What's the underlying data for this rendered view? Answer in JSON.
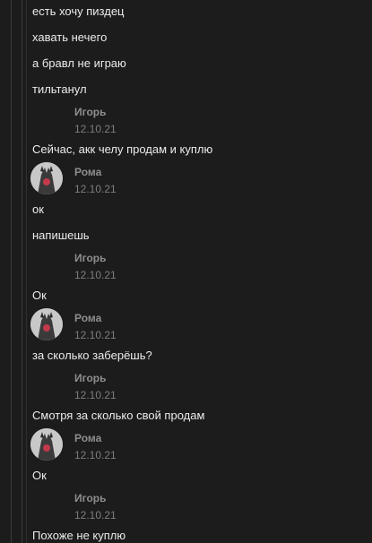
{
  "messages": [
    {
      "text": "есть хочу пиздец"
    },
    {
      "text": "хавать нечего"
    },
    {
      "text": "а бравл не играю"
    },
    {
      "text": "тильтанул"
    },
    {
      "author": "Игорь",
      "date": "12.10.21",
      "text": "Сейчас, акк челу продам и куплю",
      "avatar": false
    },
    {
      "author": "Рома",
      "date": "12.10.21",
      "text": "ок",
      "avatar": true
    },
    {
      "text": "напишешь"
    },
    {
      "author": "Игорь",
      "date": "12.10.21",
      "text": "Ок",
      "avatar": false
    },
    {
      "author": "Рома",
      "date": "12.10.21",
      "text": "за сколько заберёшь?",
      "avatar": true
    },
    {
      "author": "Игорь",
      "date": "12.10.21",
      "text": "Смотря за сколько свой продам",
      "avatar": false
    },
    {
      "author": "Рома",
      "date": "12.10.21",
      "text": "Ок",
      "avatar": true
    },
    {
      "author": "Игорь",
      "date": "12.10.21",
      "text": "Похоже не куплю",
      "avatar": false
    }
  ]
}
